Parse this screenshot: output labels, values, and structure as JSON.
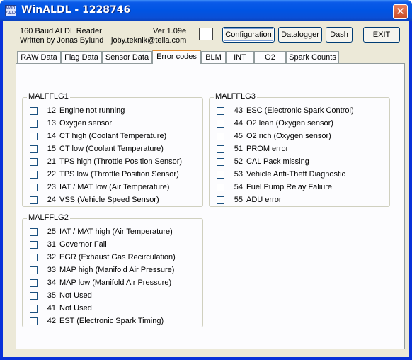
{
  "window": {
    "title": "WinALDL - 1228746",
    "icon_text": "Win ALDL",
    "close_glyph": "✕"
  },
  "header": {
    "line1": "160 Baud ALDL Reader",
    "line2": "Written by Jonas Bylund",
    "version": "Ver 1.09e",
    "email": "joby.teknik@telia.com"
  },
  "buttons": {
    "configuration": "Configuration",
    "datalogger": "Datalogger",
    "dash": "Dash",
    "exit": "EXIT"
  },
  "tabs": [
    {
      "label": "RAW Data"
    },
    {
      "label": "Flag Data"
    },
    {
      "label": "Sensor Data"
    },
    {
      "label": "Error codes"
    },
    {
      "label": "BLM"
    },
    {
      "label": "INT"
    },
    {
      "label": "O2"
    },
    {
      "label": "Spark Counts"
    }
  ],
  "active_tab": "Error codes",
  "groups": {
    "malfflg1": {
      "title": "MALFFLG1",
      "items": [
        {
          "code": "12",
          "label": "Engine not running",
          "checked": false
        },
        {
          "code": "13",
          "label": "Oxygen sensor",
          "checked": false
        },
        {
          "code": "14",
          "label": "CT high (Coolant Temperature)",
          "checked": false
        },
        {
          "code": "15",
          "label": "CT low (Coolant Temperature)",
          "checked": false
        },
        {
          "code": "21",
          "label": "TPS high (Throttle Position Sensor)",
          "checked": false
        },
        {
          "code": "22",
          "label": "TPS low (Throttle Position Sensor)",
          "checked": false
        },
        {
          "code": "23",
          "label": "IAT / MAT low (Air Temperature)",
          "checked": false
        },
        {
          "code": "24",
          "label": "VSS (Vehicle Speed Sensor)",
          "checked": false
        }
      ]
    },
    "malfflg2": {
      "title": "MALFFLG2",
      "items": [
        {
          "code": "25",
          "label": "IAT / MAT high (Air Temperature)",
          "checked": false
        },
        {
          "code": "31",
          "label": "Governor Fail",
          "checked": false
        },
        {
          "code": "32",
          "label": "EGR (Exhaust Gas Recirculation)",
          "checked": false
        },
        {
          "code": "33",
          "label": "MAP high (Manifold Air Pressure)",
          "checked": false
        },
        {
          "code": "34",
          "label": "MAP low (Manifold Air Pressure)",
          "checked": false
        },
        {
          "code": "35",
          "label": "Not Used",
          "checked": false
        },
        {
          "code": "41",
          "label": "Not Used",
          "checked": false
        },
        {
          "code": "42",
          "label": "EST (Electronic Spark Timing)",
          "checked": false
        }
      ]
    },
    "malfflg3": {
      "title": "MALFFLG3",
      "items": [
        {
          "code": "43",
          "label": "ESC (Electronic Spark Control)",
          "checked": false
        },
        {
          "code": "44",
          "label": "O2 lean (Oxygen sensor)",
          "checked": false
        },
        {
          "code": "45",
          "label": "O2 rich (Oxygen sensor)",
          "checked": false
        },
        {
          "code": "51",
          "label": "PROM error",
          "checked": false
        },
        {
          "code": "52",
          "label": "CAL Pack missing",
          "checked": false
        },
        {
          "code": "53",
          "label": "Vehicle Anti-Theft Diagnostic",
          "checked": false
        },
        {
          "code": "54",
          "label": "Fuel Pump Relay Faliure",
          "checked": false
        },
        {
          "code": "55",
          "label": "ADU error",
          "checked": false
        }
      ]
    }
  }
}
